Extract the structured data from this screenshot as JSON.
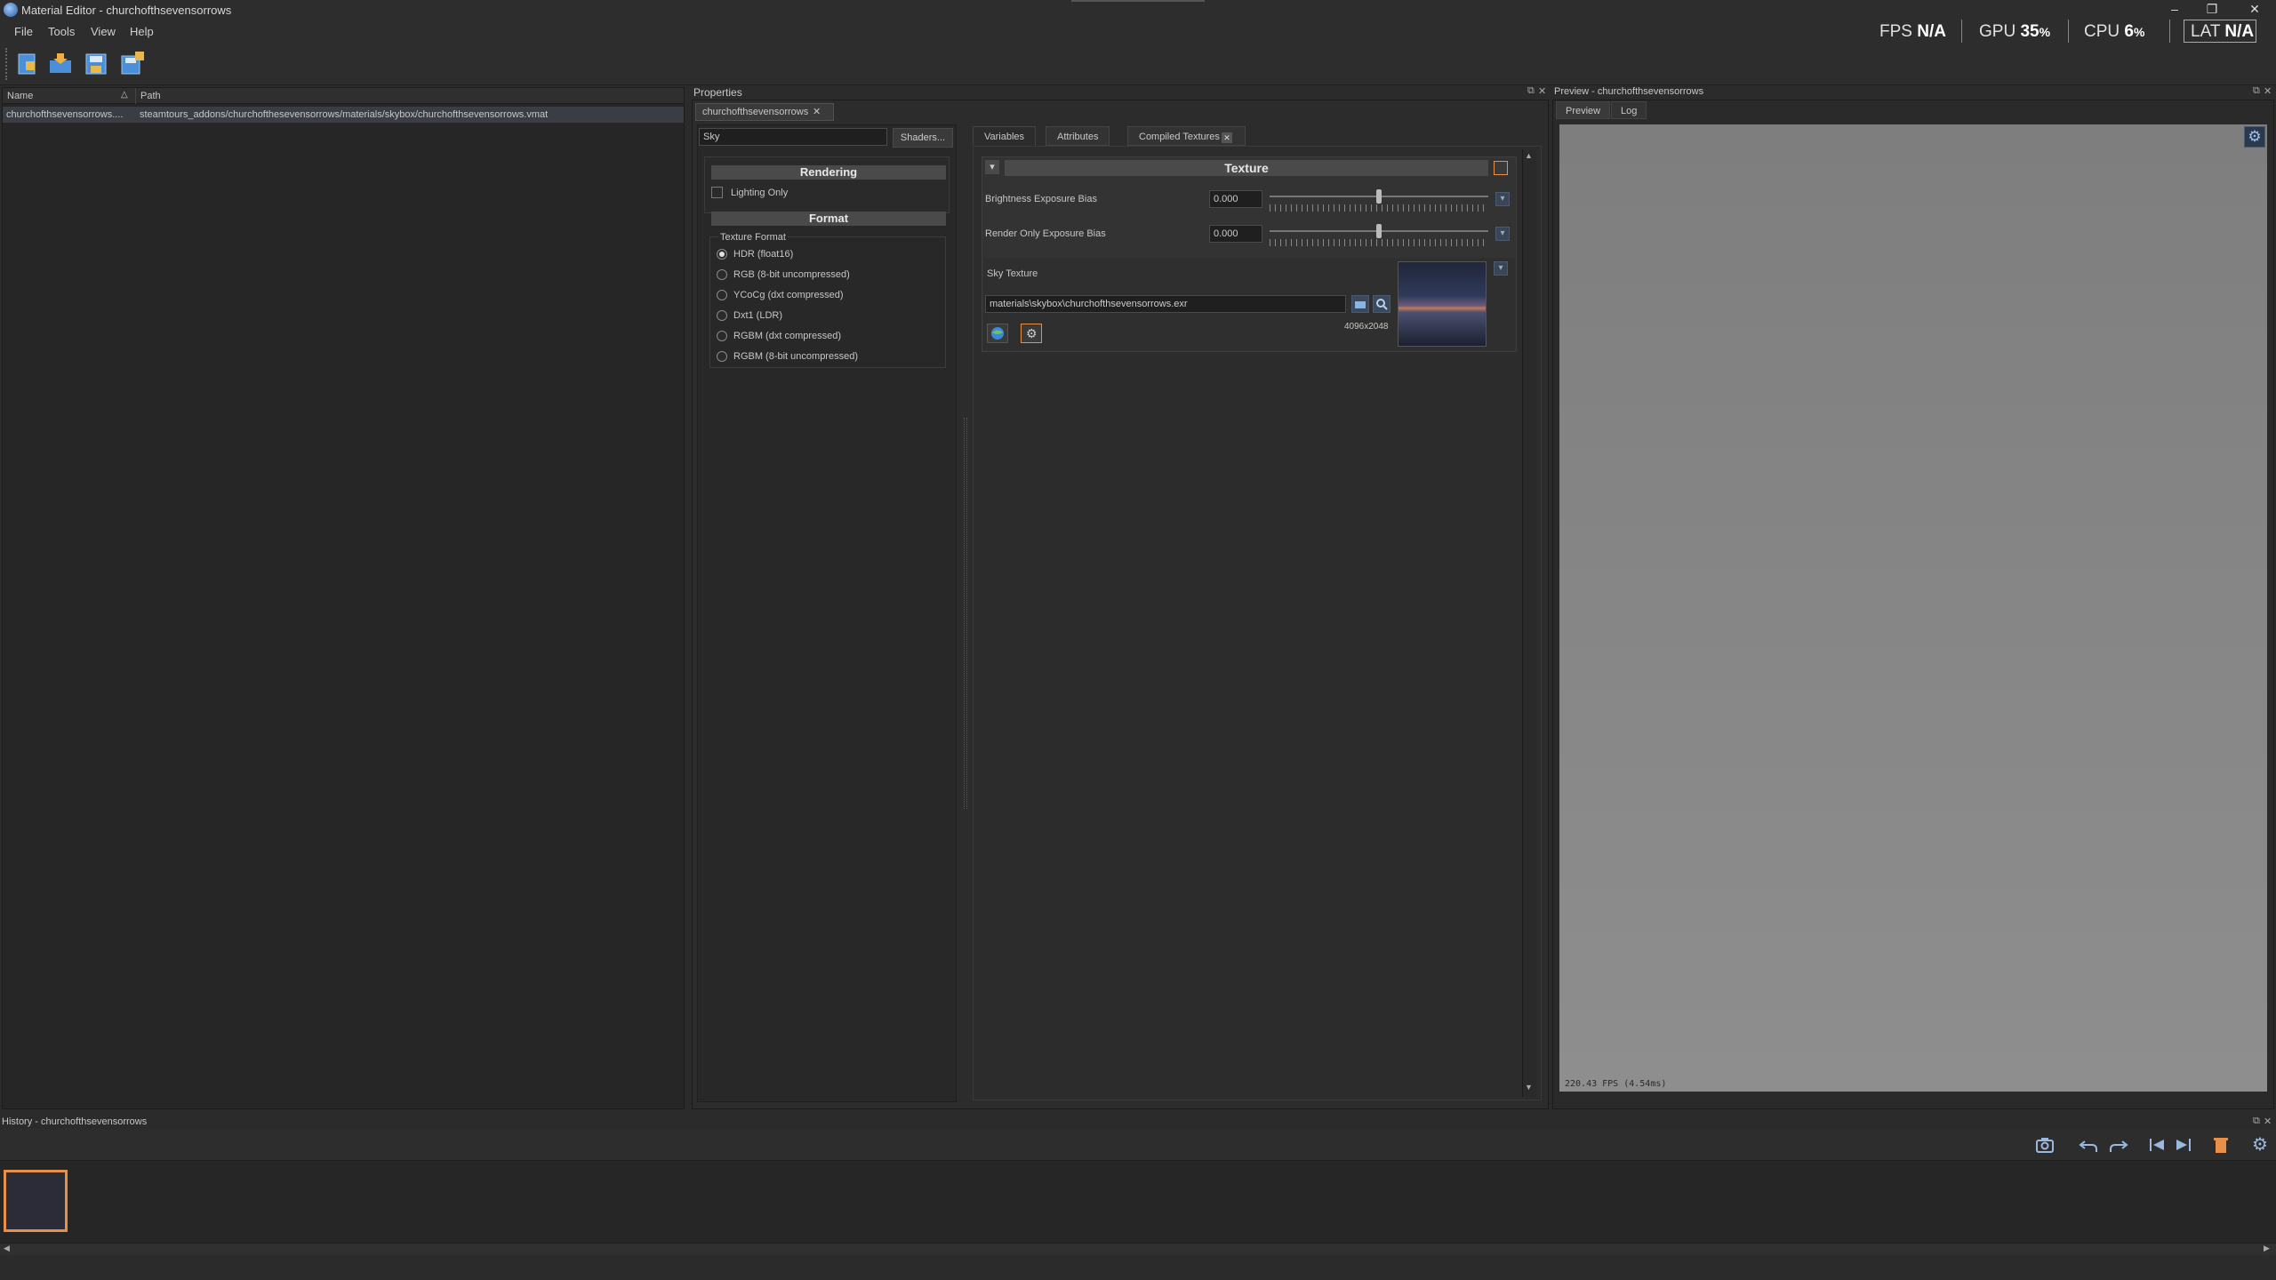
{
  "window": {
    "title": "Material Editor - churchofthsevensorrows"
  },
  "menu": [
    "File",
    "Tools",
    "View",
    "Help"
  ],
  "perf": {
    "fps_label": "FPS",
    "fps_value": "N/A",
    "gpu_label": "GPU",
    "gpu_value": "35",
    "cpu_label": "CPU",
    "cpu_value": "6",
    "lat_label": "LAT",
    "lat_value": "N/A",
    "percent": "%"
  },
  "browser": {
    "col_name": "Name",
    "col_path": "Path",
    "rows": [
      {
        "name": "churchofthsevensorrows....",
        "path": "steamtours_addons/churchofthesevensorrows/materials/skybox/churchofthsevensorrows.vmat"
      }
    ]
  },
  "properties": {
    "title": "Properties",
    "doc_tab": "churchofthsevensorrows",
    "shader_field": "Sky",
    "shaders_button": "Shaders...",
    "rendering_header": "Rendering",
    "lighting_only": "Lighting Only",
    "format_header": "Format",
    "texture_format_label": "Texture Format",
    "formats": [
      {
        "label": "HDR (float16)",
        "selected": true
      },
      {
        "label": "RGB (8-bit uncompressed)",
        "selected": false
      },
      {
        "label": "YCoCg (dxt compressed)",
        "selected": false
      },
      {
        "label": "Dxt1 (LDR)",
        "selected": false
      },
      {
        "label": "RGBM (dxt compressed)",
        "selected": false
      },
      {
        "label": "RGBM (8-bit uncompressed)",
        "selected": false
      }
    ],
    "tabs": [
      "Variables",
      "Attributes",
      "Compiled Textures"
    ],
    "texture_header": "Texture",
    "brightness_label": "Brightness Exposure Bias",
    "brightness_value": "0.000",
    "brightness_level": 0.5,
    "render_only_label": "Render Only Exposure Bias",
    "render_only_value": "0.000",
    "render_only_level": 0.5,
    "sky_texture_label": "Sky Texture",
    "sky_texture_path": "materials\\skybox\\churchofthsevensorrows.exr",
    "sky_texture_size": "4096x2048"
  },
  "preview": {
    "title": "Preview - churchofthsevensorrows",
    "tabs": [
      "Preview",
      "Log"
    ],
    "fps_readout": "220.43 FPS (4.54ms)"
  },
  "history": {
    "title": "History - churchofthsevensorrows"
  },
  "icons": {
    "close": "✕",
    "float": "⧉",
    "dropdown": "▾",
    "gear": "⚙",
    "up": "▲",
    "down": "▼",
    "left": "◀",
    "right": "▶",
    "sort": "△",
    "minimize": "–",
    "restore": "❐"
  },
  "colors": {
    "accent_orange": "#e8904a",
    "toolbar_blue": "#4a8fd8",
    "panel_bg": "#262626",
    "viewport_gray": "#8e8e8e"
  }
}
